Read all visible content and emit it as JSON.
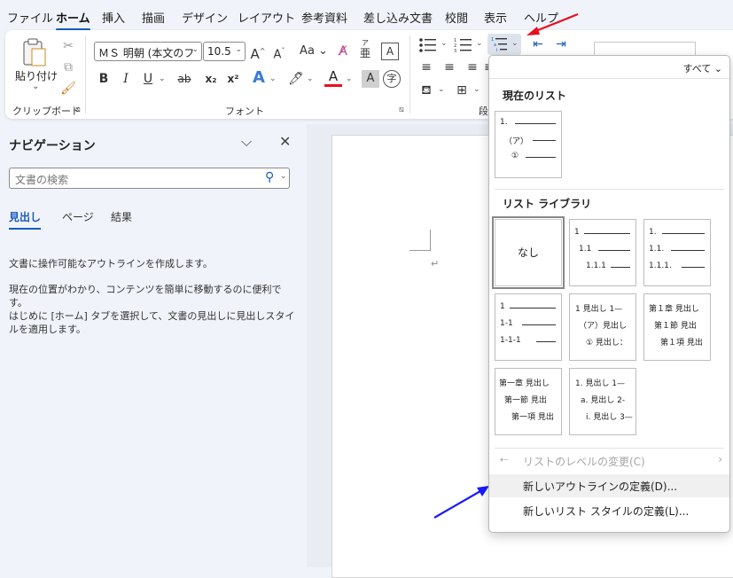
{
  "menu": [
    "ファイル",
    "ホーム",
    "挿入",
    "描画",
    "デザイン",
    "レイアウト",
    "参考資料",
    "差し込み文書",
    "校閲",
    "表示",
    "ヘルプ"
  ],
  "ribbon": {
    "paste_label": "貼り付け",
    "paste_dd": "⌄",
    "clipboard_label": "クリップボード",
    "font_label": "フォント",
    "paragraph_label": "段",
    "font_name": "ＭＳ 明朝 (本文のフ",
    "font_size": "10.5",
    "aa_label": "Aa",
    "bold": "B",
    "italic": "I",
    "underline": "U",
    "strike": "ab",
    "sub": "x₂",
    "sup": "x²",
    "ruby_kana": "ア",
    "ruby_kanji": "亜",
    "enclose": "字"
  },
  "nav": {
    "title": "ナビゲーション",
    "search_placeholder": "文書の検索",
    "tabs": [
      "見出し",
      "ページ",
      "結果"
    ],
    "text1": "文書に操作可能なアウトラインを作成します。",
    "text2": "現在の位置がわかり、コンテンツを簡単に移動するのに便利です。",
    "text3": "はじめに [ホーム] タブを選択して、文書の見出しに見出しスタイルを適用します。"
  },
  "popup": {
    "filter": "すべて",
    "current_title": "現在のリスト",
    "library_title": "リスト ライブラリ",
    "none_label": "なし",
    "current": {
      "l1": "1.",
      "l2": "（ア）",
      "l3": "①"
    },
    "tiles": {
      "t2": [
        "1",
        "1.1",
        "1.1.1"
      ],
      "t3": [
        "1.",
        "1.1.",
        "1.1.1."
      ],
      "t4": [
        "1",
        "1-1",
        "1-1-1"
      ],
      "t5": [
        "1 見出し 1—",
        "（ア）見出し",
        "① 見出し："
      ],
      "t6": [
        "第１章 見出し",
        "第１節 見出",
        "第１項 見出"
      ],
      "t7": [
        "第一章 見出し",
        "第一節 見出",
        "第一項 見出"
      ],
      "t8": [
        "1. 見出し 1—",
        "a. 見出し 2-",
        "i. 見出し 3—"
      ]
    },
    "items": [
      "リストのレベルの変更(C)",
      "新しいアウトラインの定義(D)...",
      "新しいリスト スタイルの定義(L)..."
    ]
  },
  "colors": {
    "accent": "#185abd",
    "annotation_red": "#e8101f",
    "annotation_blue": "#1a1aff"
  }
}
